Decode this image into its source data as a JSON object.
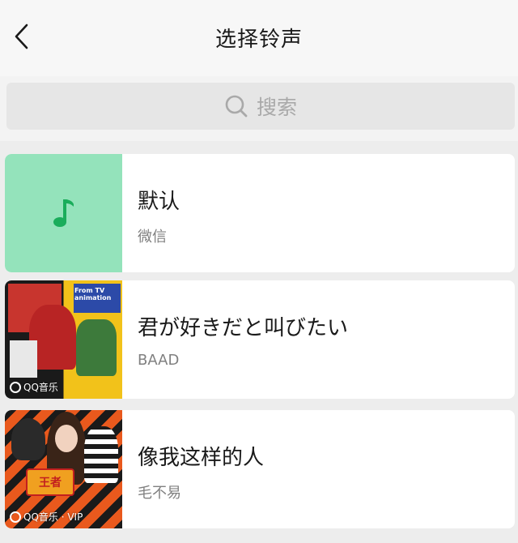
{
  "header": {
    "title": "选择铃声",
    "back_icon": "chevron-left-icon"
  },
  "search": {
    "placeholder": "搜索",
    "icon": "search-icon"
  },
  "ringtones": [
    {
      "title": "默认",
      "artist": "微信",
      "cover": "music-note-icon",
      "cover_color": "#94e3bb",
      "note_color": "#1aad5b"
    },
    {
      "title": "君が好きだと叫びたい",
      "artist": "BAAD",
      "badge": "QQ音乐",
      "cover_top_text": "From TV animation"
    },
    {
      "title": "像我这样的人",
      "artist": "毛不易",
      "badge": "QQ音乐 · VIP",
      "cover_logo_text": "王者"
    }
  ]
}
